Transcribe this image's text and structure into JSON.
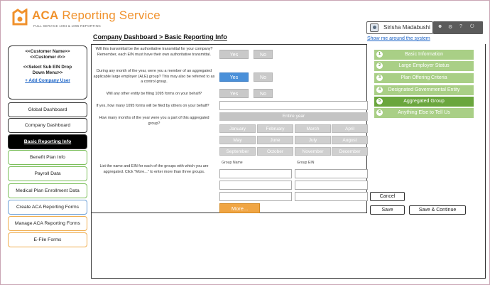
{
  "header": {
    "brand_bold": "ACA",
    "brand_rest": " Reporting Service",
    "tagline": "FULL SERVICE 1094 & 1095 REPORTING",
    "user_name": "Sirisha Madabushi",
    "show_me": "Show me around the system",
    "breadcrumb": "Company Dashboard > Basic Reporting Info"
  },
  "customer": {
    "name": "<<Customer Name>>",
    "number": "<<Customer #>>",
    "sub_ein": "<<Select Sub EIN Drop",
    "sub_ein2": "Down Menu>>",
    "add_company": "+ Add Company User"
  },
  "nav": {
    "global": "Global Dashboard",
    "company": "Company Dashboard",
    "basic": "Basic Reporting Info",
    "benefit": "Benefit Plan Info",
    "payroll": "Payroll Data",
    "medical": "Medical Plan Enrollment Data",
    "create": "Create ACA Reporting Forms",
    "manage": "Manage ACA Reporting Forms",
    "efile": "E-File Forms"
  },
  "questions": {
    "q1": "Will this transmittal be the authoritative transmittal for your company? Remember, each EIN must have their own authoritative transmittal.",
    "q2": "During any month of the year, were you a member of an aggregated applicable large employer (ALE) group? This may also be referred to as a control group.",
    "q3": "Will any other entity be filing 1095 forms on your behalf?",
    "q4": "If yes, how many 1095 forms will be filed by others on your behalf?",
    "q5": "How many months of the year were you a part of this aggregated group?",
    "q6": "List the name and EIN for each of the groups with which you are aggregated. Click \"More...\" to enter more than three groups."
  },
  "buttons": {
    "yes": "Yes",
    "no": "No",
    "entire_year": "Entire year",
    "more": "More...",
    "cancel": "Cancel",
    "save": "Save",
    "save_continue": "Save & Continue"
  },
  "months": [
    "January",
    "February",
    "March",
    "April",
    "May",
    "June",
    "July",
    "August",
    "September",
    "October",
    "November",
    "December"
  ],
  "columns": {
    "group_name": "Group Name",
    "group_ein": "Group EIN"
  },
  "steps": [
    {
      "num": "1",
      "label": "Basic Information"
    },
    {
      "num": "2",
      "label": "Large Employer Status"
    },
    {
      "num": "3",
      "label": "Plan Offering Criteria"
    },
    {
      "num": "4",
      "label": "Designated Governmental Entity"
    },
    {
      "num": "5",
      "label": "Aggregated Group"
    },
    {
      "num": "6",
      "label": "Anything Else to Tell Us"
    }
  ],
  "colors": {
    "brand": "#f0912b",
    "step": "#a9cf86",
    "step_active": "#6aa63d",
    "selected": "#4a90d9",
    "more": "#f0a543"
  }
}
